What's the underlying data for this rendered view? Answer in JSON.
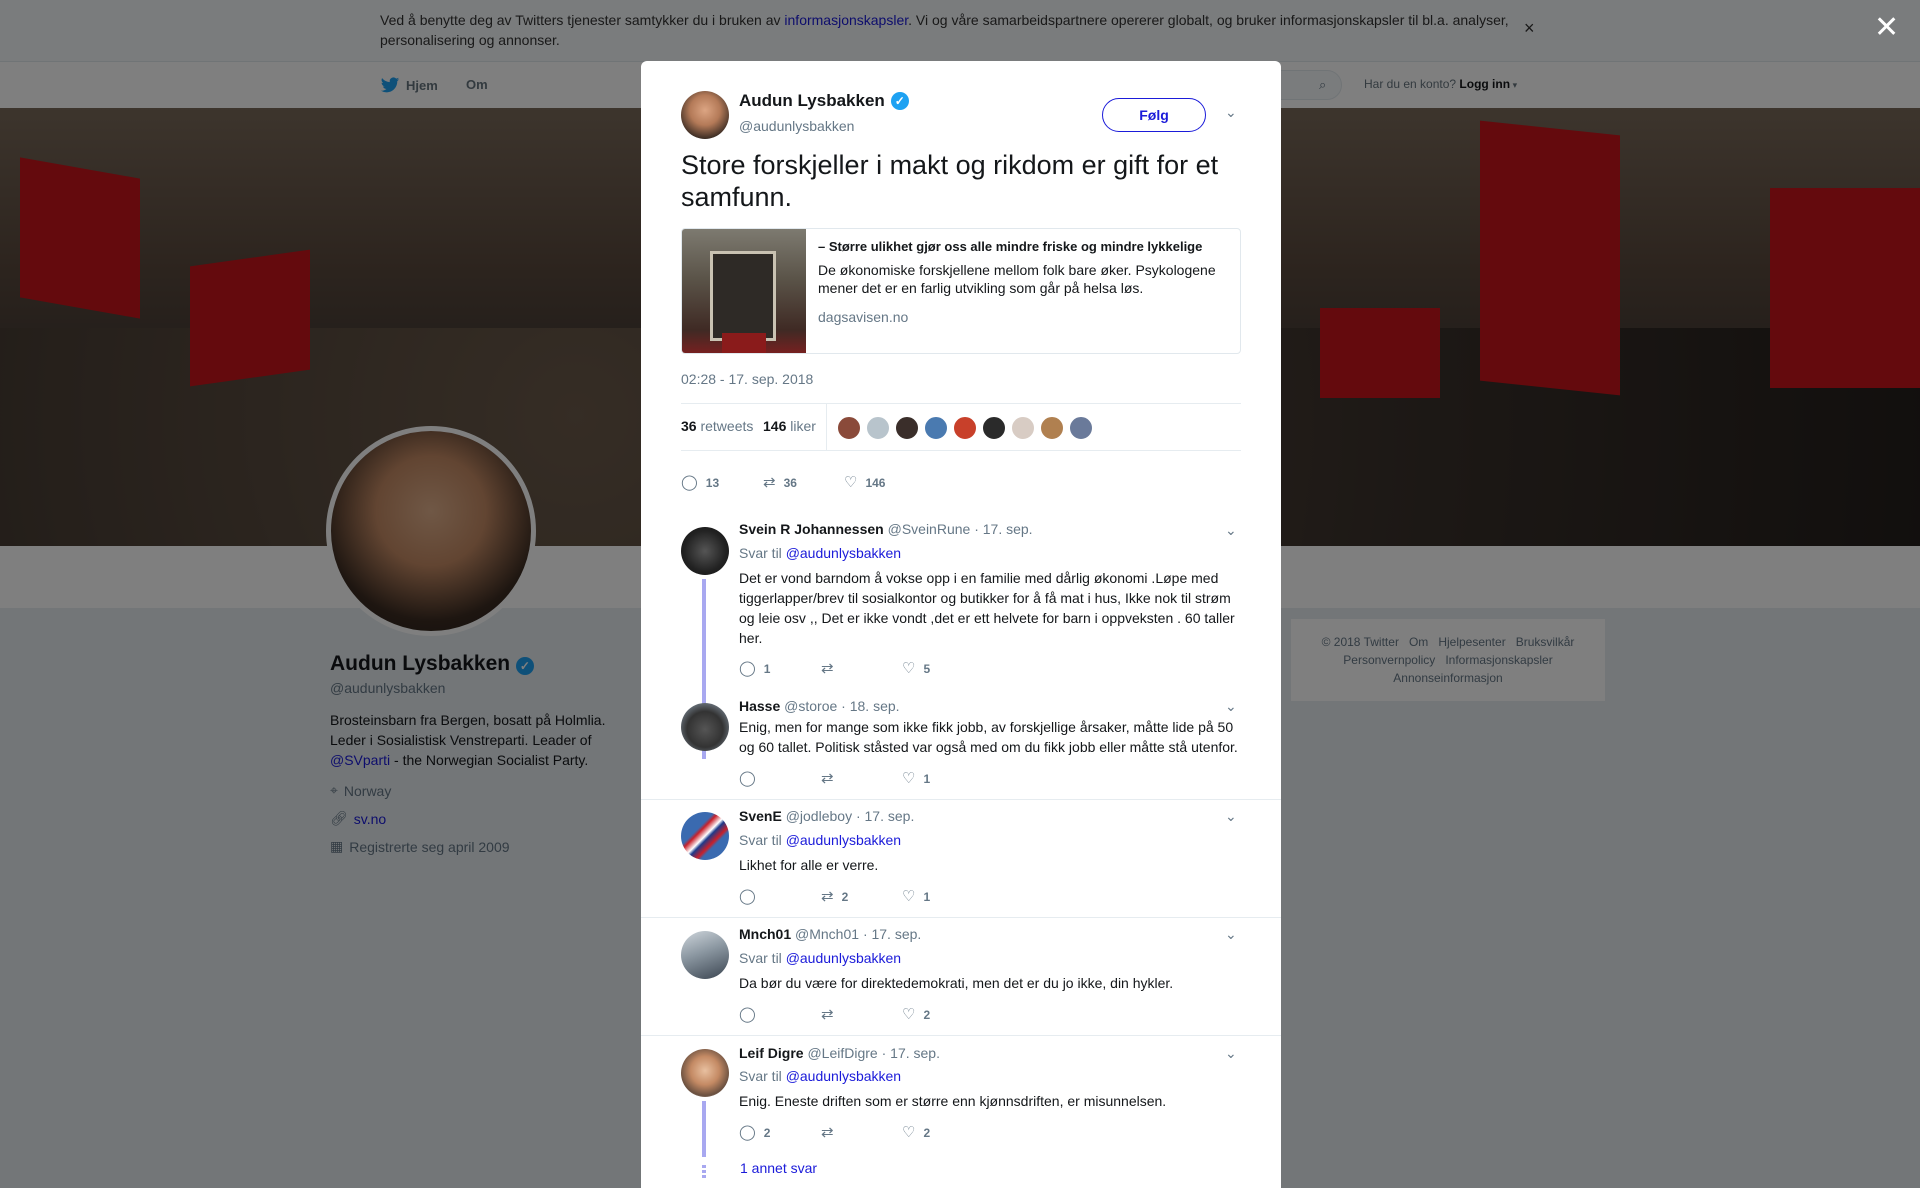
{
  "cookie": {
    "text_before": "Ved å benytte deg av Twitters tjenester samtykker du i bruken av ",
    "link": "informasjonskapsler",
    "text_after": ". Vi og våre samarbeidspartnere opererer globalt, og bruker informasjonskapsler til bl.a. analyser, personalisering og annonser.",
    "close": "×"
  },
  "nav": {
    "home": "Hjem",
    "about": "Om",
    "login_prompt": "Har du en konto?",
    "login": "Logg inn"
  },
  "profile": {
    "name": "Audun Lysbakken",
    "handle": "@audunlysbakken",
    "bio_1": "Brosteinsbarn fra Bergen, bosatt på Holmlia. Leder i Sosialistisk Venstreparti. Leader of ",
    "bio_link": "@SVparti",
    "bio_2": " - the Norwegian Socialist Party.",
    "location": "Norway",
    "url": "sv.no",
    "joined": "Registrerte seg april 2009"
  },
  "footer": {
    "items": [
      "© 2018 Twitter",
      "Om",
      "Hjelpesenter",
      "Bruksvilkår",
      "Personvernpolicy",
      "Informasjonskapsler",
      "Annonseinformasjon"
    ]
  },
  "modal": {
    "close": "✕",
    "author": "Audun Lysbakken",
    "handle": "@audunlysbakken",
    "follow": "Følg",
    "text": "Store forskjeller i makt og rikdom er gift for et samfunn.",
    "card": {
      "title": "– Større ulikhet gjør oss alle mindre friske og mindre lykkelige",
      "desc": "De økonomiske forskjellene mellom folk bare øker. Psykologene mener det er en farlig utvikling som går på helsa løs.",
      "domain": "dagsavisen.no"
    },
    "time": "02:28 - 17. sep. 2018",
    "retweets": "36",
    "retweets_label": "retweets",
    "likes": "146",
    "likes_label": "liker",
    "actions": {
      "replies": "13",
      "retweets": "36",
      "likes": "146"
    }
  },
  "replies": [
    {
      "name": "Svein R Johannessen",
      "handle": "@SveinRune",
      "date": "· 17. sep.",
      "svar": "Svar til ",
      "to": "@audunlysbakken",
      "text": "Det er vond barndom å vokse opp i en familie med dårlig økonomi .Løpe med tiggerlapper/brev til sosialkontor og butikker for å få mat i hus, Ikke nok til strøm og leie  osv ,, Det er ikke vondt  ,det er ett helvete for barn i oppveksten . 60 taller her.",
      "replies": "1",
      "retweets": "",
      "likes": "5"
    },
    {
      "name": "Hasse",
      "handle": "@storoe",
      "date": "· 18. sep.",
      "svar": "",
      "to": "",
      "text": "Enig, men for mange som ikke fikk jobb, av forskjellige årsaker, måtte lide på 50 og 60 tallet. Politisk ståsted var også med om du fikk jobb eller måtte stå utenfor.",
      "replies": "",
      "retweets": "",
      "likes": "1"
    },
    {
      "name": "SvenE",
      "handle": "@jodleboy",
      "date": "· 17. sep.",
      "svar": "Svar til ",
      "to": "@audunlysbakken",
      "text": "Likhet for alle er verre.",
      "replies": "",
      "retweets": "2",
      "likes": "1"
    },
    {
      "name": "Mnch01",
      "handle": "@Mnch01",
      "date": "· 17. sep.",
      "svar": "Svar til ",
      "to": "@audunlysbakken",
      "text": "Da bør du være for direktedemokrati, men det er du jo ikke, din hykler.",
      "replies": "",
      "retweets": "",
      "likes": "2"
    },
    {
      "name": "Leif Digre",
      "handle": "@LeifDigre",
      "date": "· 17. sep.",
      "svar": "Svar til ",
      "to": "@audunlysbakken",
      "text": "Enig. Eneste driften som er større enn kjønnsdriften, er misunnelsen.",
      "replies": "2",
      "retweets": "",
      "likes": "2"
    }
  ],
  "more_replies": "1 annet svar",
  "colors": {
    "link": "#1b1bd9",
    "verified": "#1da1f2",
    "thread": "#a8a8f0"
  }
}
